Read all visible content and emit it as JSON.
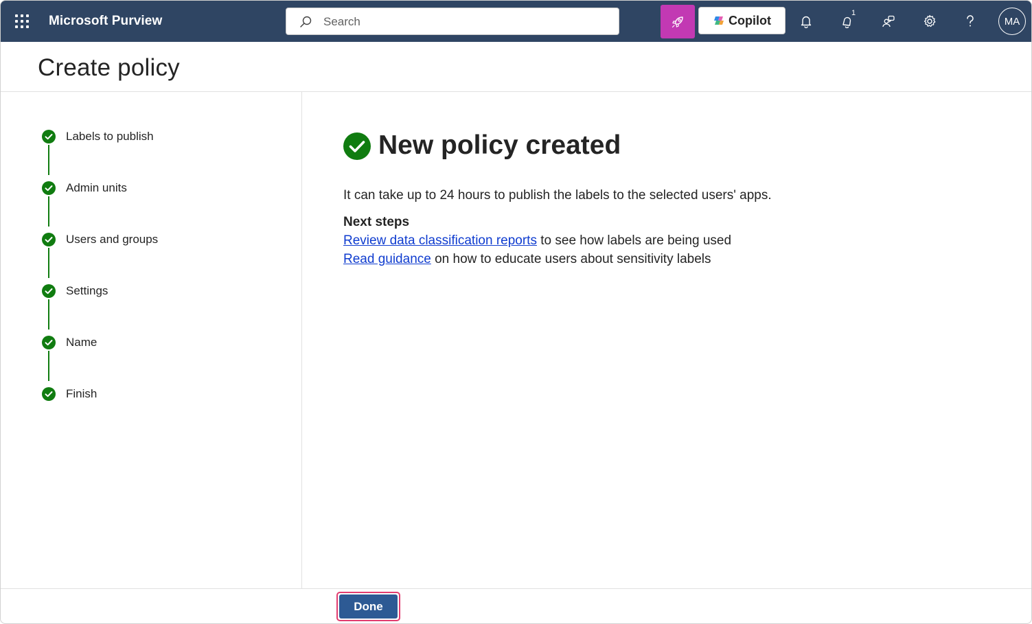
{
  "header": {
    "app_name": "Microsoft Purview",
    "search_placeholder": "Search",
    "copilot_label": "Copilot",
    "notification_badge": "1",
    "avatar_initials": "MA",
    "icons": [
      "app-launcher-icon",
      "search-icon",
      "rocket-icon",
      "copilot-icon",
      "bell-icon",
      "notifications-icon",
      "community-icon",
      "settings-icon",
      "help-icon"
    ],
    "colors": {
      "bar": "#2f4563",
      "rocket_button": "#c239b3"
    }
  },
  "page": {
    "title": "Create policy"
  },
  "steps": [
    {
      "label": "Labels to publish",
      "status": "complete"
    },
    {
      "label": "Admin units",
      "status": "complete"
    },
    {
      "label": "Users and groups",
      "status": "complete"
    },
    {
      "label": "Settings",
      "status": "complete"
    },
    {
      "label": "Name",
      "status": "complete"
    },
    {
      "label": "Finish",
      "status": "complete"
    }
  ],
  "main": {
    "heading": "New policy created",
    "description": "It can take up to 24 hours to publish the labels to the selected users' apps.",
    "next_steps_title": "Next steps",
    "next_steps": [
      {
        "link": "Review data classification reports",
        "text": " to see how labels are being used"
      },
      {
        "link": "Read guidance",
        "text": " on how to educate users about sensitivity labels"
      }
    ],
    "colors": {
      "success": "#107c10",
      "link": "#0f3ccf"
    }
  },
  "footer": {
    "done_label": "Done",
    "colors": {
      "button": "#2d5a94",
      "highlight": "#e23c6f"
    }
  }
}
